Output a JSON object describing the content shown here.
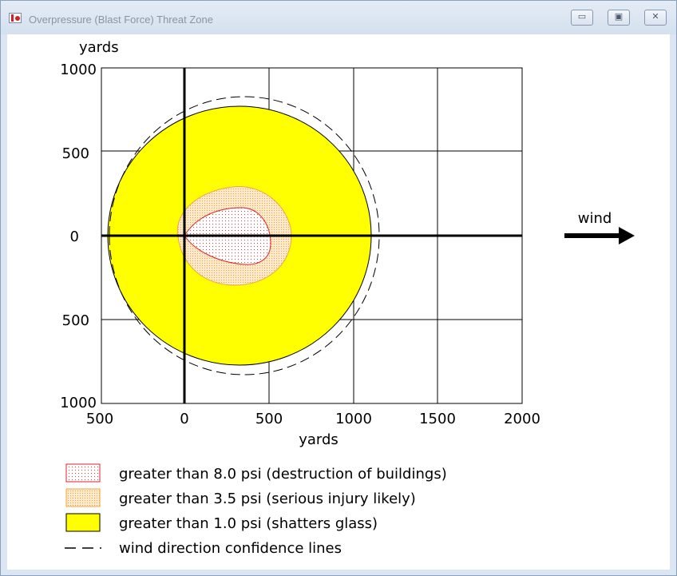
{
  "window": {
    "title": "Overpressure (Blast Force) Threat Zone",
    "buttons": [
      {
        "name": "minimize",
        "glyph": "▭"
      },
      {
        "name": "maximize",
        "glyph": "▣"
      },
      {
        "name": "close",
        "glyph": "✕"
      }
    ]
  },
  "chart_data": {
    "type": "area",
    "ylabel": "yards",
    "xlabel": "yards",
    "x_ticks": [
      "500",
      "0",
      "500",
      "1000",
      "1500",
      "2000"
    ],
    "x_tick_values": [
      -500,
      0,
      500,
      1000,
      1500,
      2000
    ],
    "y_ticks": [
      "1000",
      "500",
      "0",
      "500",
      "1000"
    ],
    "y_tick_values": [
      1000,
      500,
      0,
      -500,
      -1000
    ],
    "xlim": [
      -500,
      2000
    ],
    "ylim": [
      -1000,
      1000
    ],
    "grid": true,
    "zones": [
      {
        "psi": 8.0,
        "label": "greater than 8.0 psi (destruction of buildings)",
        "x_extent": [
          0,
          500
        ],
        "y_extent": [
          -170,
          160
        ],
        "color": "#ffffff",
        "stroke": "#e02020"
      },
      {
        "psi": 3.5,
        "label": "greater than 3.5 psi (serious injury likely)",
        "x_extent": [
          -40,
          630
        ],
        "y_extent": [
          -290,
          290
        ],
        "color": "#fbe5c3",
        "stroke": "#f2a63a"
      },
      {
        "psi": 1.0,
        "label": "greater than 1.0 psi (shatters glass)",
        "x_extent": [
          -450,
          1100
        ],
        "y_extent": [
          -770,
          770
        ],
        "color": "#ffff00",
        "stroke": "#000000"
      }
    ],
    "confidence_lines": {
      "label": "wind direction confidence lines",
      "style": "dashed"
    },
    "wind": {
      "label": "wind",
      "direction": "east"
    }
  }
}
